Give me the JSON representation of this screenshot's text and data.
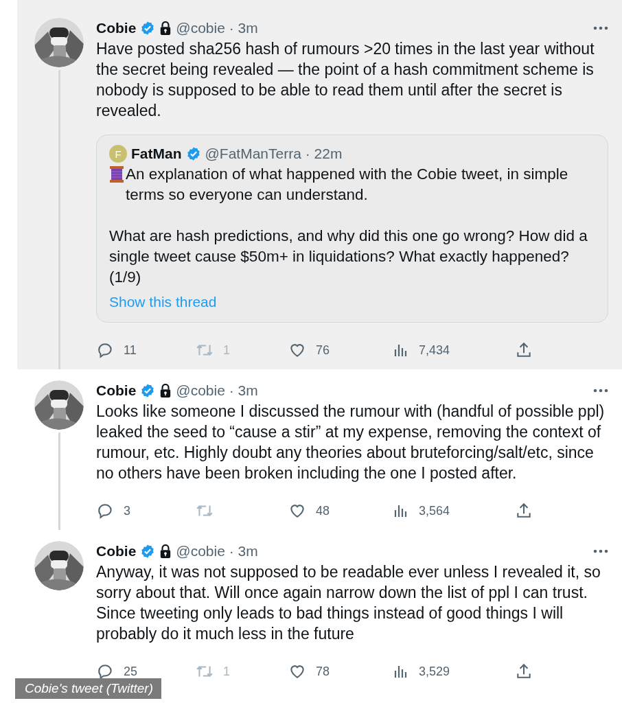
{
  "tweets": [
    {
      "highlighted": true,
      "connected": true,
      "name": "Cobie",
      "verified": true,
      "protected": true,
      "meta": "@cobie · 3m",
      "text": "Have posted sha256 hash of rumours >20 times in the last year without the secret being revealed — the point of a hash commitment scheme is nobody is supposed to be able to read them until after the secret is revealed.",
      "quote": {
        "initial": "F",
        "color": "#c8c070",
        "name": "FatMan",
        "verified": true,
        "meta": "@FatManTerra · 22m",
        "paragraphs": [
          "An explanation of what happened with the Cobie tweet, in simple terms so everyone can understand.",
          "What are hash predictions, and why did this one go wrong? How did a single tweet cause $50m+ in liquidations? What exactly happened? (1/9)"
        ],
        "link": "Show this thread"
      },
      "stats": {
        "replies": "11",
        "retweets": "1",
        "retweet_disabled": true,
        "likes": "76",
        "views": "7,434"
      }
    },
    {
      "highlighted": false,
      "connected": true,
      "name": "Cobie",
      "verified": true,
      "protected": true,
      "meta": "@cobie · 3m",
      "text": "Looks like someone I discussed the rumour with (handful of possible ppl) leaked the seed to “cause a stir” at my expense, removing the context of rumour, etc. Highly doubt any theories about bruteforcing/salt/etc, since no others have been broken including the one I posted after.",
      "stats": {
        "replies": "3",
        "retweet_disabled": true,
        "likes": "48",
        "views": "3,564"
      }
    },
    {
      "highlighted": false,
      "connected": false,
      "name": "Cobie",
      "verified": true,
      "protected": true,
      "meta": "@cobie · 3m",
      "text": "Anyway, it was not supposed to be readable ever unless I revealed it, so sorry about that. Will once again narrow down the list of ppl I can trust. Since tweeting only leads to bad things instead of good things I will probably do it much less in the future",
      "stats": {
        "replies": "25",
        "retweets": "1",
        "retweet_disabled": true,
        "likes": "78",
        "views": "3,529"
      }
    }
  ],
  "caption": "Cobie's tweet (Twitter)"
}
